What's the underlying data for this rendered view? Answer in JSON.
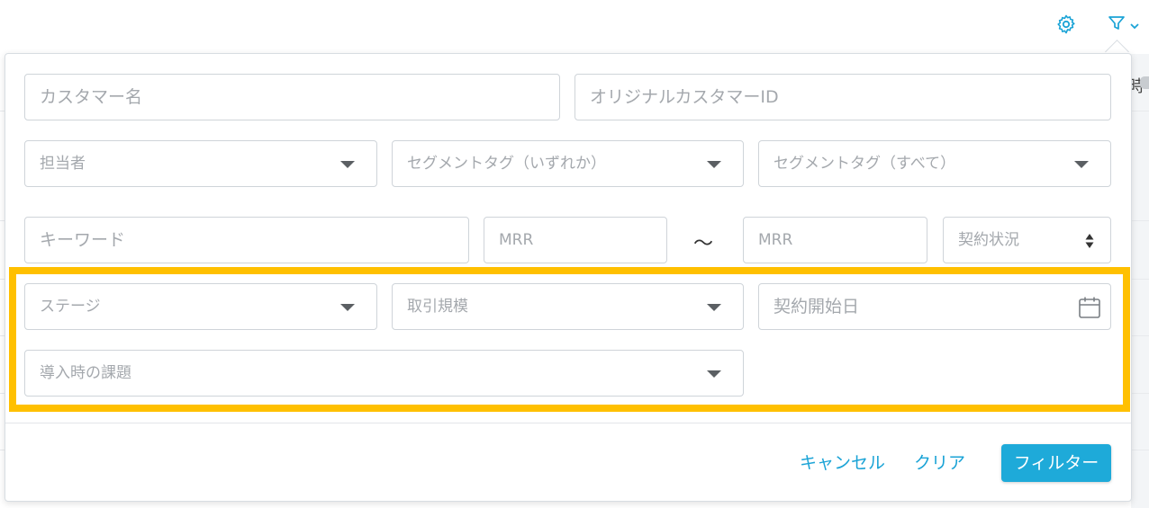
{
  "toolbar": {
    "settings_icon": "gear-icon",
    "filter_icon": "filter-icon",
    "dropdown_icon": "chevron-down-icon",
    "accent_color": "#1aa3d6"
  },
  "background": {
    "cut_text": "時"
  },
  "filters": {
    "customer_name": {
      "placeholder": "カスタマー名"
    },
    "original_customer_id": {
      "placeholder": "オリジナルカスタマーID"
    },
    "assignee": {
      "placeholder": "担当者"
    },
    "segment_tag_any": {
      "placeholder": "セグメントタグ（いずれか）"
    },
    "segment_tag_all": {
      "placeholder": "セグメントタグ（すべて）"
    },
    "keyword": {
      "placeholder": "キーワード"
    },
    "mrr_min": {
      "placeholder": "MRR"
    },
    "range_separator": "～",
    "mrr_max": {
      "placeholder": "MRR"
    },
    "contract_status": {
      "placeholder": "契約状況"
    },
    "stage": {
      "placeholder": "ステージ"
    },
    "deal_size": {
      "placeholder": "取引規模"
    },
    "contract_start_date": {
      "placeholder": "契約開始日"
    },
    "onboarding_issue": {
      "placeholder": "導入時の課題"
    }
  },
  "highlight_color": "#ffc000",
  "actions": {
    "cancel_label": "キャンセル",
    "clear_label": "クリア",
    "filter_label": "フィルター"
  }
}
